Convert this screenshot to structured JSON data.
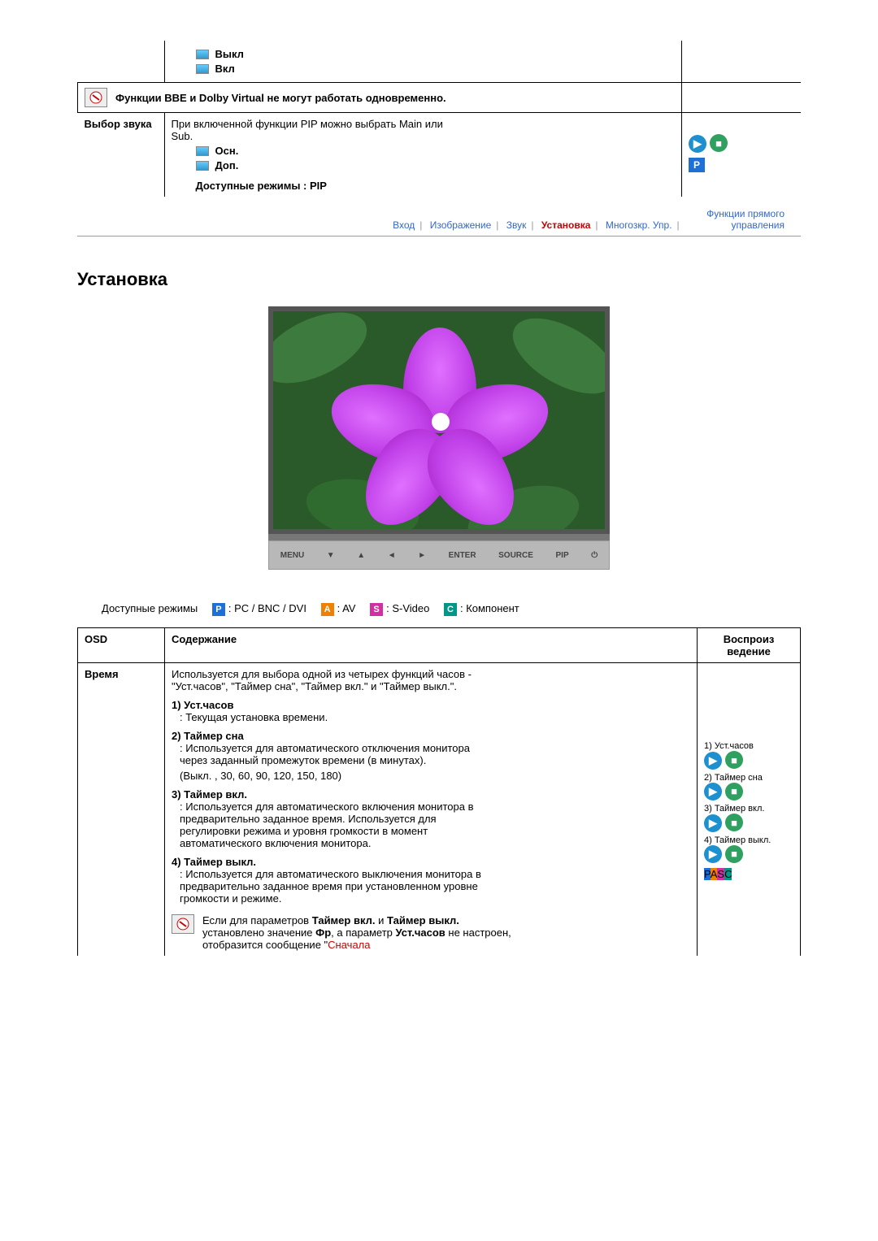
{
  "top_table": {
    "row1": {
      "opt1": "Выкл",
      "opt2": "Вкл"
    },
    "note": "Функции BBE и Dolby Virtual не могут работать одновременно.",
    "row3": {
      "label": "Выбор звука",
      "desc": "При включенной функции PIP можно выбрать Main или Sub.",
      "opt1": "Осн.",
      "opt2": "Доп.",
      "modes": "Доступные режимы : PIP"
    }
  },
  "nav": {
    "i1": "Вход",
    "i2": "Изображение",
    "i3": "Звук",
    "i4": "Установка",
    "i5": "Многозкр. Упр.",
    "i6": "Функции прямого управления"
  },
  "section_title": "Установка",
  "monitor_buttons": [
    "MENU",
    "▼",
    "▲",
    "◄",
    "►",
    "ENTER",
    "SOURCE",
    "PIP",
    "⏻"
  ],
  "modes_line": {
    "label": "Доступные режимы",
    "p": ": PC / BNC / DVI",
    "a": ": AV",
    "s": ": S-Video",
    "c": ": Компонент"
  },
  "table2": {
    "h1": "OSD",
    "h2": "Содержание",
    "h3": "Воспроиз ведение",
    "row": {
      "label": "Время",
      "intro": "Используется для выбора одной из четырех функций часов - \"Уст.часов\", \"Таймер сна\", \"Таймер вкл.\" и \"Таймер выкл.\".",
      "s1_h": "1) Уст.часов",
      "s1_t": ": Текущая установка времени.",
      "s2_h": "2) Таймер сна",
      "s2_t": ": Используется для автоматического отключения монитора через заданный промежуток времени (в минутах).",
      "s2_v": "(Выкл. , 30, 60, 90, 120, 150, 180)",
      "s3_h": "3) Таймер вкл.",
      "s3_t": ": Используется для автоматического включения монитора в предварительно заданное время. Используется для регулировки режима и уровня громкости в момент автоматического включения монитора.",
      "s4_h": "4) Таймер выкл.",
      "s4_t": ": Используется для автоматического выключения монитора в предварительно заданное время при установленном уровне громкости и режиме.",
      "note_a": "Если для параметров ",
      "note_b": "Таймер вкл.",
      "note_c": " и ",
      "note_d": "Таймер выкл.",
      "note_e": " установлено значение ",
      "note_f": "Фр",
      "note_g": ", а параметр ",
      "note_h": "Уст.часов",
      "note_i": " не настроен, отобразится сообщение \"",
      "note_j": "Сначала",
      "side": {
        "l1": "1) Уст.часов",
        "l2": "2) Таймер сна",
        "l3": "3) Таймер вкл.",
        "l4": "4) Таймер выкл."
      }
    }
  },
  "icon_letters": {
    "p": "P",
    "a": "A",
    "s": "S",
    "c": "C"
  }
}
